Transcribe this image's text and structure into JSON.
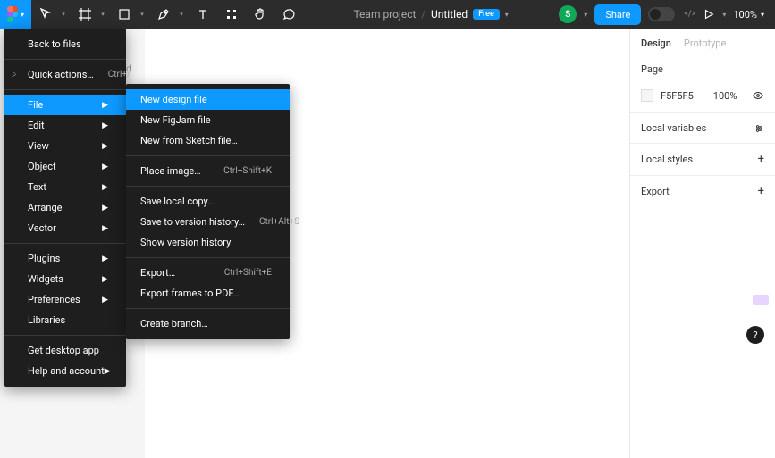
{
  "toolbar": {
    "breadcrumb_team": "Team project",
    "file_name": "Untitled",
    "badge": "Free",
    "avatar_initial": "S",
    "share_label": "Share",
    "zoom": "100%"
  },
  "right_panel": {
    "tabs": {
      "design": "Design",
      "prototype": "Prototype"
    },
    "page_label": "Page",
    "bg_hex": "F5F5F5",
    "bg_opacity": "100%",
    "local_variables": "Local variables",
    "local_styles": "Local styles",
    "export": "Export"
  },
  "main_menu": {
    "back": "Back to files",
    "quick_actions": "Quick actions…",
    "quick_shortcut": "Ctrl+/",
    "file": "File",
    "edit": "Edit",
    "view": "View",
    "object": "Object",
    "text": "Text",
    "arrange": "Arrange",
    "vector": "Vector",
    "plugins": "Plugins",
    "widgets": "Widgets",
    "preferences": "Preferences",
    "libraries": "Libraries",
    "desktop": "Get desktop app",
    "help": "Help and account"
  },
  "file_submenu": {
    "new_design": "New design file",
    "new_figjam": "New FigJam file",
    "new_sketch": "New from Sketch file…",
    "place_image": "Place image…",
    "place_shortcut": "Ctrl+Shift+K",
    "save_local": "Save local copy…",
    "save_version": "Save to version history…",
    "save_version_shortcut": "Ctrl+Alt+S",
    "show_version": "Show version history",
    "export": "Export…",
    "export_shortcut": "Ctrl+Shift+E",
    "export_pdf": "Export frames to PDF…",
    "create_branch": "Create branch…"
  },
  "left_hint": "d"
}
